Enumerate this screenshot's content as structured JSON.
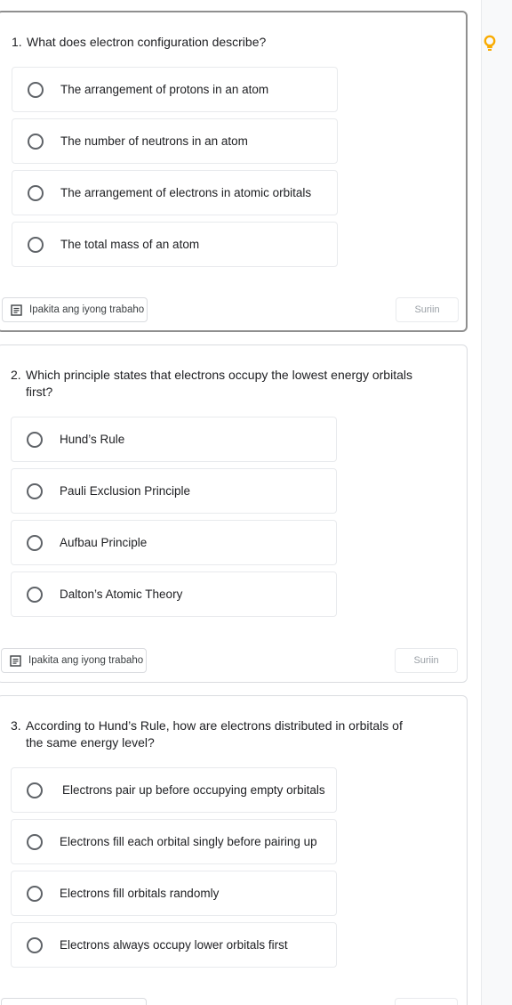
{
  "questions": [
    {
      "number": "1.",
      "text": "What does electron configuration describe?",
      "options": [
        "The arrangement of protons in an atom",
        "The number of neutrons in an atom",
        "The arrangement of electrons in atomic orbitals",
        "The total mass of an atom"
      ],
      "show_work_label": "Ipakita ang iyong trabaho",
      "check_label": "Suriin"
    },
    {
      "number": "2.",
      "text": "Which principle states that electrons occupy the lowest energy orbitals first?",
      "options": [
        "Hund’s Rule",
        "Pauli Exclusion Principle",
        "Aufbau Principle",
        "Dalton’s Atomic Theory"
      ],
      "show_work_label": "Ipakita ang iyong trabaho",
      "check_label": "Suriin"
    },
    {
      "number": "3.",
      "text": "According to Hund’s Rule, how are electrons distributed in orbitals of the same energy level?",
      "options": [
        "Electrons pair up before occupying empty orbitals",
        "Electrons fill each orbital singly before pairing up",
        "Electrons fill orbitals randomly",
        "Electrons always occupy lower orbitals first"
      ]
    }
  ],
  "colors": {
    "hint": "#f9ab00",
    "border": "#dadce0",
    "active_border": "#8f8f8f",
    "radio": "#5f6368",
    "disabled_text": "#9aa0a6"
  },
  "icons": {
    "hint": "lightbulb-icon",
    "show_work": "notes-icon"
  }
}
